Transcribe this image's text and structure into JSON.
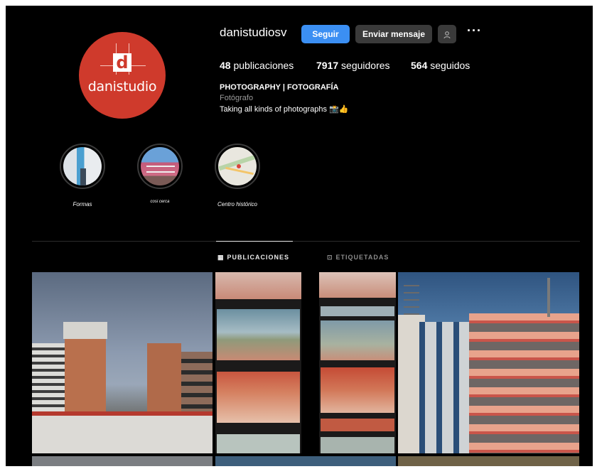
{
  "profile": {
    "avatar_text": "danistudio",
    "avatar_letter": "d",
    "username": "danistudiosv",
    "follow_label": "Seguir",
    "message_label": "Enviar mensaje",
    "more_label": "···"
  },
  "stats": {
    "posts_count": "48",
    "posts_label": "publicaciones",
    "followers_count": "7917",
    "followers_label": "seguidores",
    "following_count": "564",
    "following_label": "seguidos"
  },
  "bio": {
    "name": "PHOTOGRAPHY | FOTOGRAFÍA",
    "category": "Fotógrafo",
    "text": "Taking all kinds of photographs 📸👍"
  },
  "highlights": [
    {
      "label": "Formas"
    },
    {
      "label": "cosi cerca"
    },
    {
      "label": "Centro histórico"
    }
  ],
  "tabs": {
    "posts": "PUBLICACIONES",
    "tagged": "ETIQUETADAS"
  },
  "colors": {
    "accent": "#3b8ff3",
    "brand": "#cf3a2c"
  }
}
